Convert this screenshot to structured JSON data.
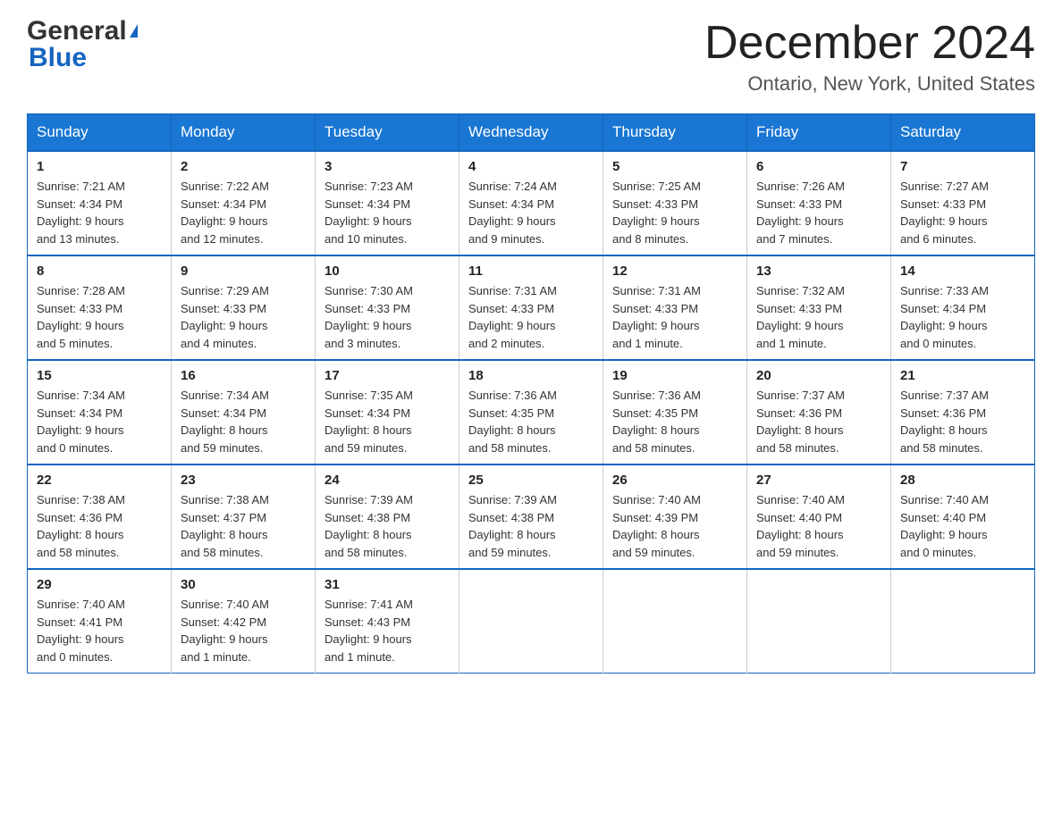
{
  "header": {
    "logo_line1": "General",
    "logo_line2": "Blue",
    "month_title": "December 2024",
    "location": "Ontario, New York, United States"
  },
  "weekdays": [
    "Sunday",
    "Monday",
    "Tuesday",
    "Wednesday",
    "Thursday",
    "Friday",
    "Saturday"
  ],
  "weeks": [
    [
      {
        "day": "1",
        "sunrise": "7:21 AM",
        "sunset": "4:34 PM",
        "daylight": "9 hours and 13 minutes."
      },
      {
        "day": "2",
        "sunrise": "7:22 AM",
        "sunset": "4:34 PM",
        "daylight": "9 hours and 12 minutes."
      },
      {
        "day": "3",
        "sunrise": "7:23 AM",
        "sunset": "4:34 PM",
        "daylight": "9 hours and 10 minutes."
      },
      {
        "day": "4",
        "sunrise": "7:24 AM",
        "sunset": "4:34 PM",
        "daylight": "9 hours and 9 minutes."
      },
      {
        "day": "5",
        "sunrise": "7:25 AM",
        "sunset": "4:33 PM",
        "daylight": "9 hours and 8 minutes."
      },
      {
        "day": "6",
        "sunrise": "7:26 AM",
        "sunset": "4:33 PM",
        "daylight": "9 hours and 7 minutes."
      },
      {
        "day": "7",
        "sunrise": "7:27 AM",
        "sunset": "4:33 PM",
        "daylight": "9 hours and 6 minutes."
      }
    ],
    [
      {
        "day": "8",
        "sunrise": "7:28 AM",
        "sunset": "4:33 PM",
        "daylight": "9 hours and 5 minutes."
      },
      {
        "day": "9",
        "sunrise": "7:29 AM",
        "sunset": "4:33 PM",
        "daylight": "9 hours and 4 minutes."
      },
      {
        "day": "10",
        "sunrise": "7:30 AM",
        "sunset": "4:33 PM",
        "daylight": "9 hours and 3 minutes."
      },
      {
        "day": "11",
        "sunrise": "7:31 AM",
        "sunset": "4:33 PM",
        "daylight": "9 hours and 2 minutes."
      },
      {
        "day": "12",
        "sunrise": "7:31 AM",
        "sunset": "4:33 PM",
        "daylight": "9 hours and 1 minute."
      },
      {
        "day": "13",
        "sunrise": "7:32 AM",
        "sunset": "4:33 PM",
        "daylight": "9 hours and 1 minute."
      },
      {
        "day": "14",
        "sunrise": "7:33 AM",
        "sunset": "4:34 PM",
        "daylight": "9 hours and 0 minutes."
      }
    ],
    [
      {
        "day": "15",
        "sunrise": "7:34 AM",
        "sunset": "4:34 PM",
        "daylight": "9 hours and 0 minutes."
      },
      {
        "day": "16",
        "sunrise": "7:34 AM",
        "sunset": "4:34 PM",
        "daylight": "8 hours and 59 minutes."
      },
      {
        "day": "17",
        "sunrise": "7:35 AM",
        "sunset": "4:34 PM",
        "daylight": "8 hours and 59 minutes."
      },
      {
        "day": "18",
        "sunrise": "7:36 AM",
        "sunset": "4:35 PM",
        "daylight": "8 hours and 58 minutes."
      },
      {
        "day": "19",
        "sunrise": "7:36 AM",
        "sunset": "4:35 PM",
        "daylight": "8 hours and 58 minutes."
      },
      {
        "day": "20",
        "sunrise": "7:37 AM",
        "sunset": "4:36 PM",
        "daylight": "8 hours and 58 minutes."
      },
      {
        "day": "21",
        "sunrise": "7:37 AM",
        "sunset": "4:36 PM",
        "daylight": "8 hours and 58 minutes."
      }
    ],
    [
      {
        "day": "22",
        "sunrise": "7:38 AM",
        "sunset": "4:36 PM",
        "daylight": "8 hours and 58 minutes."
      },
      {
        "day": "23",
        "sunrise": "7:38 AM",
        "sunset": "4:37 PM",
        "daylight": "8 hours and 58 minutes."
      },
      {
        "day": "24",
        "sunrise": "7:39 AM",
        "sunset": "4:38 PM",
        "daylight": "8 hours and 58 minutes."
      },
      {
        "day": "25",
        "sunrise": "7:39 AM",
        "sunset": "4:38 PM",
        "daylight": "8 hours and 59 minutes."
      },
      {
        "day": "26",
        "sunrise": "7:40 AM",
        "sunset": "4:39 PM",
        "daylight": "8 hours and 59 minutes."
      },
      {
        "day": "27",
        "sunrise": "7:40 AM",
        "sunset": "4:40 PM",
        "daylight": "8 hours and 59 minutes."
      },
      {
        "day": "28",
        "sunrise": "7:40 AM",
        "sunset": "4:40 PM",
        "daylight": "9 hours and 0 minutes."
      }
    ],
    [
      {
        "day": "29",
        "sunrise": "7:40 AM",
        "sunset": "4:41 PM",
        "daylight": "9 hours and 0 minutes."
      },
      {
        "day": "30",
        "sunrise": "7:40 AM",
        "sunset": "4:42 PM",
        "daylight": "9 hours and 1 minute."
      },
      {
        "day": "31",
        "sunrise": "7:41 AM",
        "sunset": "4:43 PM",
        "daylight": "9 hours and 1 minute."
      },
      null,
      null,
      null,
      null
    ]
  ],
  "labels": {
    "sunrise": "Sunrise: ",
    "sunset": "Sunset: ",
    "daylight": "Daylight: "
  }
}
